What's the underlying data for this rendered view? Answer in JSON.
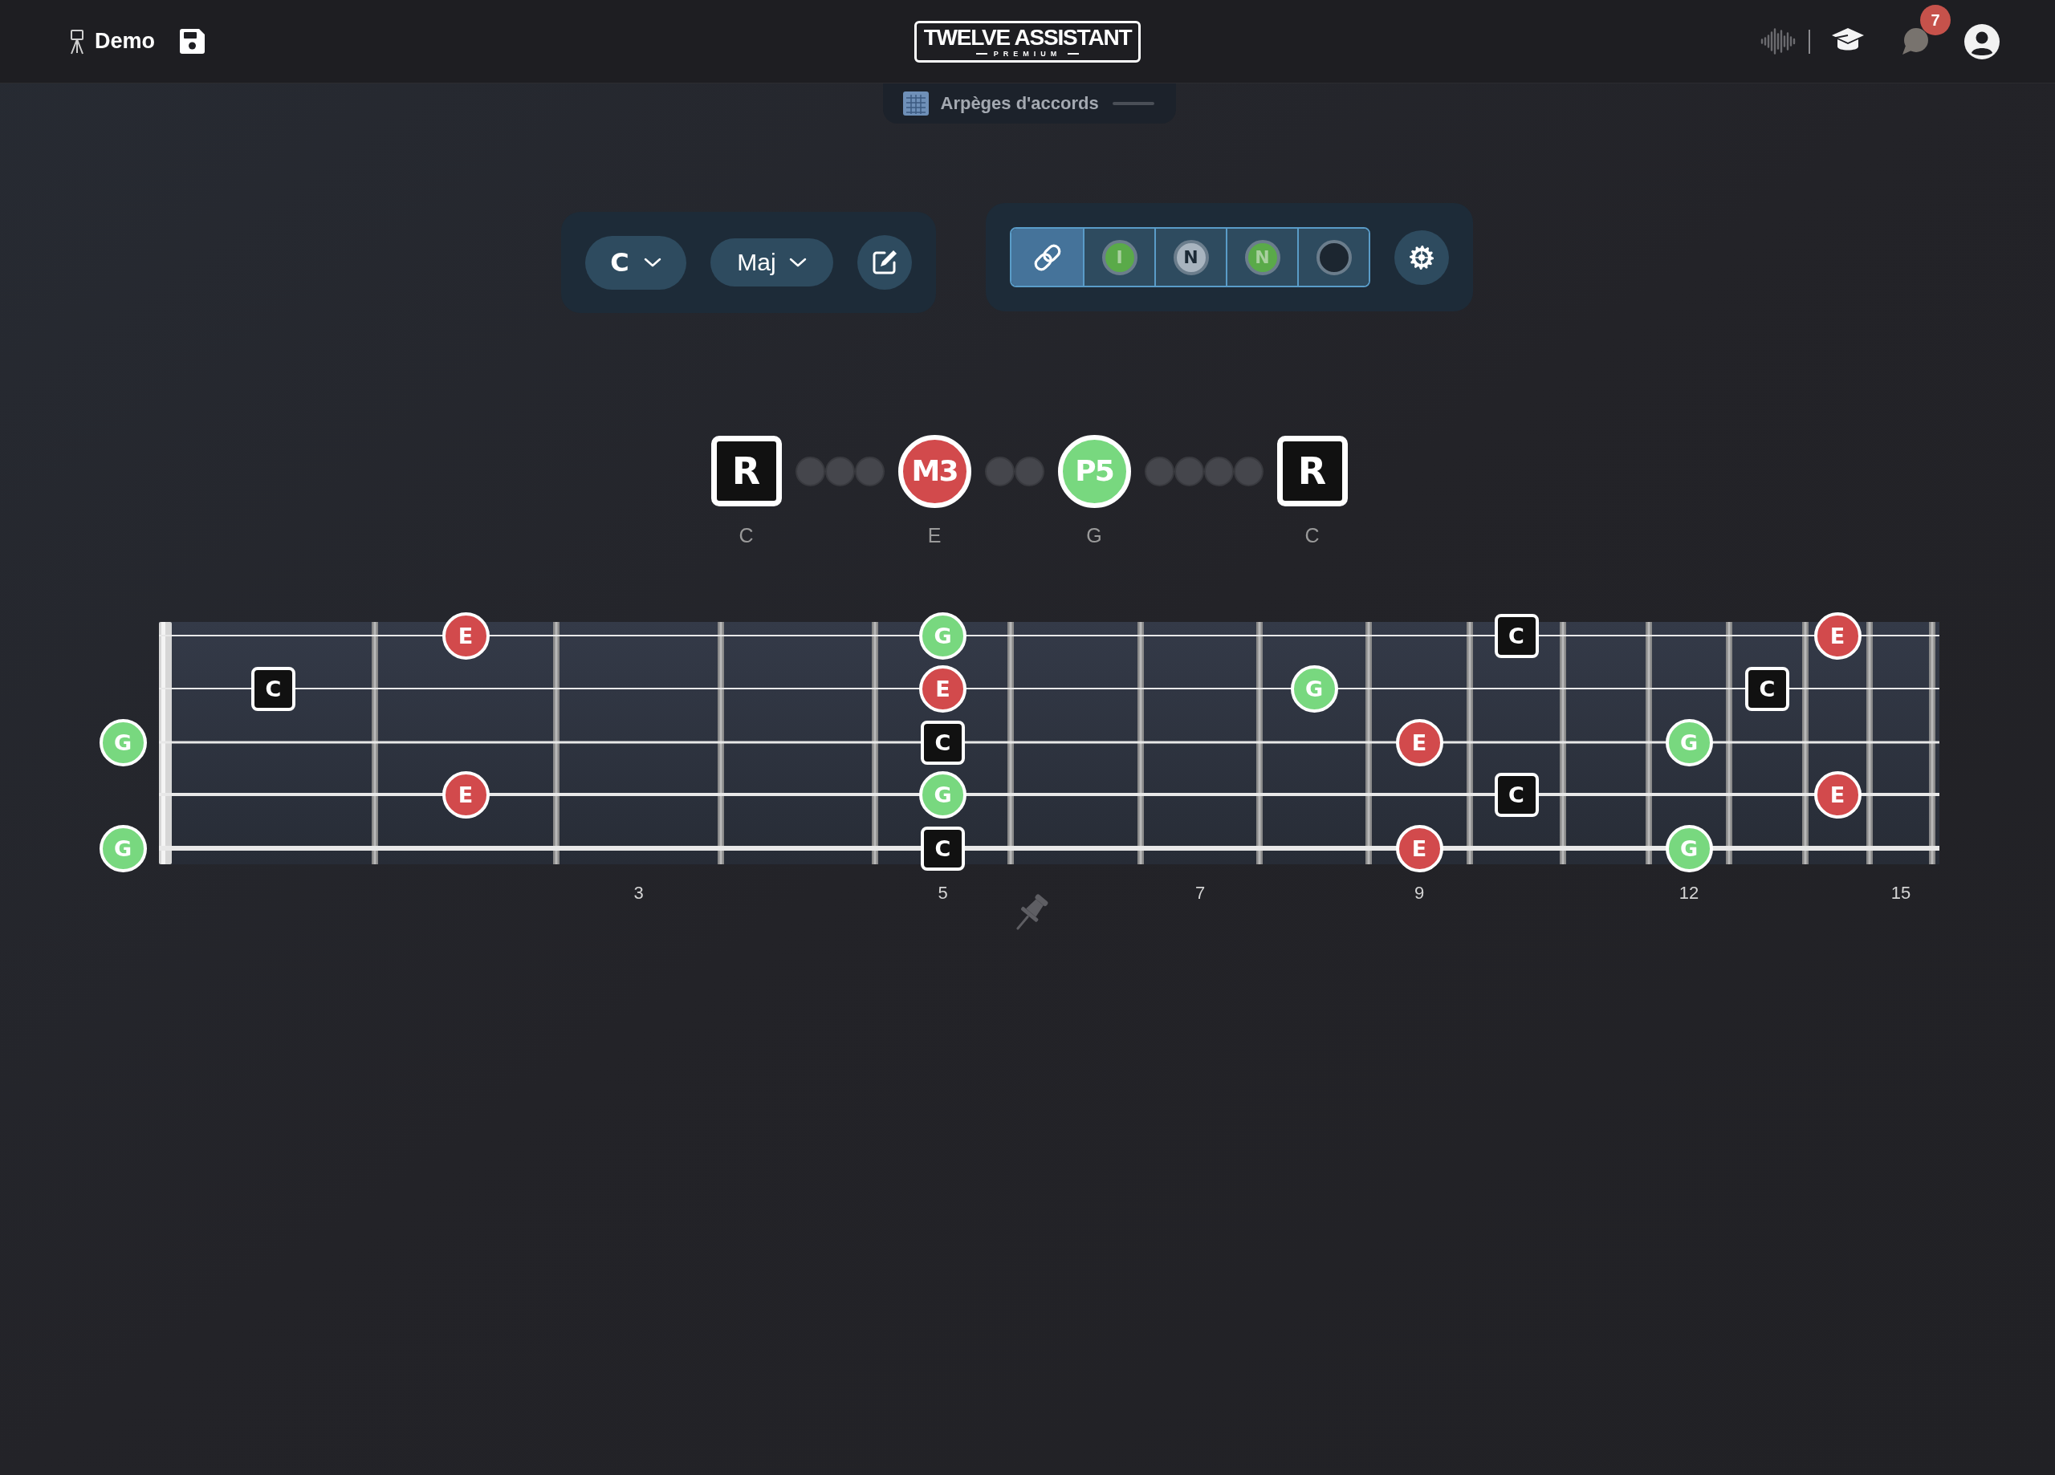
{
  "header": {
    "project_name": "Demo",
    "logo_title": "TWELVE ASSISTANT",
    "logo_subtitle": "PREMIUM",
    "notification_count": "7"
  },
  "mode_tab": {
    "label": "Arpèges d'accords"
  },
  "chord_controls": {
    "root": "C",
    "quality": "Maj"
  },
  "display_modes": [
    {
      "kind": "link",
      "selected": true
    },
    {
      "kind": "dot",
      "label": "I",
      "color": "#5aaa49",
      "selected": false
    },
    {
      "kind": "dot",
      "label": "N",
      "color": "#a8b4bf",
      "selected": false
    },
    {
      "kind": "dot",
      "label": "N",
      "color": "#5aaa49",
      "selected": false
    },
    {
      "kind": "dot",
      "color": "#1c2630",
      "selected": false
    }
  ],
  "intervals": [
    {
      "kind": "square",
      "label": "R",
      "note": "C",
      "color": "#111111"
    },
    {
      "kind": "gap"
    },
    {
      "kind": "gap"
    },
    {
      "kind": "gap"
    },
    {
      "kind": "circle",
      "label": "M3",
      "note": "E",
      "color": "#d24a4c"
    },
    {
      "kind": "gap"
    },
    {
      "kind": "gap"
    },
    {
      "kind": "circle",
      "label": "P5",
      "note": "G",
      "color": "#78d87f"
    },
    {
      "kind": "gap"
    },
    {
      "kind": "gap"
    },
    {
      "kind": "gap"
    },
    {
      "kind": "gap"
    },
    {
      "kind": "square",
      "label": "R",
      "note": "C",
      "color": "#111111"
    }
  ],
  "fretboard": {
    "strings": [
      {
        "frets": [
          {
            "kind": "empty"
          },
          {
            "kind": "empty"
          },
          {
            "kind": "circle",
            "label": "E",
            "color": "#d24a4c"
          },
          {
            "kind": "empty"
          },
          {
            "kind": "empty"
          },
          {
            "kind": "circle",
            "label": "G",
            "color": "#78d87f"
          },
          {
            "kind": "empty"
          },
          {
            "kind": "empty"
          },
          {
            "kind": "empty"
          },
          {
            "kind": "empty"
          },
          {
            "kind": "square",
            "label": "C",
            "color": "#111111"
          },
          {
            "kind": "empty"
          },
          {
            "kind": "empty"
          },
          {
            "kind": "empty"
          },
          {
            "kind": "circle",
            "label": "E",
            "color": "#d24a4c"
          },
          {
            "kind": "empty"
          }
        ]
      },
      {
        "frets": [
          {
            "kind": "empty"
          },
          {
            "kind": "square",
            "label": "C",
            "color": "#111111"
          },
          {
            "kind": "empty"
          },
          {
            "kind": "empty"
          },
          {
            "kind": "empty"
          },
          {
            "kind": "circle",
            "label": "E",
            "color": "#d24a4c"
          },
          {
            "kind": "empty"
          },
          {
            "kind": "empty"
          },
          {
            "kind": "circle",
            "label": "G",
            "color": "#78d87f"
          },
          {
            "kind": "empty"
          },
          {
            "kind": "empty"
          },
          {
            "kind": "empty"
          },
          {
            "kind": "empty"
          },
          {
            "kind": "square",
            "label": "C",
            "color": "#111111"
          },
          {
            "kind": "empty"
          },
          {
            "kind": "empty"
          }
        ]
      },
      {
        "frets": [
          {
            "kind": "circle",
            "label": "G",
            "color": "#78d87f"
          },
          {
            "kind": "empty"
          },
          {
            "kind": "empty"
          },
          {
            "kind": "empty"
          },
          {
            "kind": "empty"
          },
          {
            "kind": "square",
            "label": "C",
            "color": "#111111"
          },
          {
            "kind": "empty"
          },
          {
            "kind": "empty"
          },
          {
            "kind": "empty"
          },
          {
            "kind": "circle",
            "label": "E",
            "color": "#d24a4c"
          },
          {
            "kind": "empty"
          },
          {
            "kind": "empty"
          },
          {
            "kind": "circle",
            "label": "G",
            "color": "#78d87f"
          },
          {
            "kind": "empty"
          },
          {
            "kind": "empty"
          },
          {
            "kind": "empty"
          }
        ]
      },
      {
        "frets": [
          {
            "kind": "empty"
          },
          {
            "kind": "empty"
          },
          {
            "kind": "circle",
            "label": "E",
            "color": "#d24a4c"
          },
          {
            "kind": "empty"
          },
          {
            "kind": "empty"
          },
          {
            "kind": "circle",
            "label": "G",
            "color": "#78d87f"
          },
          {
            "kind": "empty"
          },
          {
            "kind": "empty"
          },
          {
            "kind": "empty"
          },
          {
            "kind": "empty"
          },
          {
            "kind": "square",
            "label": "C",
            "color": "#111111"
          },
          {
            "kind": "empty"
          },
          {
            "kind": "empty"
          },
          {
            "kind": "empty"
          },
          {
            "kind": "circle",
            "label": "E",
            "color": "#d24a4c"
          },
          {
            "kind": "empty"
          }
        ]
      },
      {
        "frets": [
          {
            "kind": "circle",
            "label": "G",
            "color": "#78d87f"
          },
          {
            "kind": "empty"
          },
          {
            "kind": "empty"
          },
          {
            "kind": "empty"
          },
          {
            "kind": "empty"
          },
          {
            "kind": "square",
            "label": "C",
            "color": "#111111"
          },
          {
            "kind": "empty"
          },
          {
            "kind": "empty"
          },
          {
            "kind": "empty"
          },
          {
            "kind": "circle",
            "label": "E",
            "color": "#d24a4c"
          },
          {
            "kind": "empty"
          },
          {
            "kind": "empty"
          },
          {
            "kind": "circle",
            "label": "G",
            "color": "#78d87f"
          },
          {
            "kind": "empty"
          },
          {
            "kind": "empty"
          },
          {
            "kind": "empty"
          }
        ]
      }
    ],
    "fret_numbers": [
      "3",
      "5",
      "7",
      "9",
      "12",
      "15"
    ]
  }
}
